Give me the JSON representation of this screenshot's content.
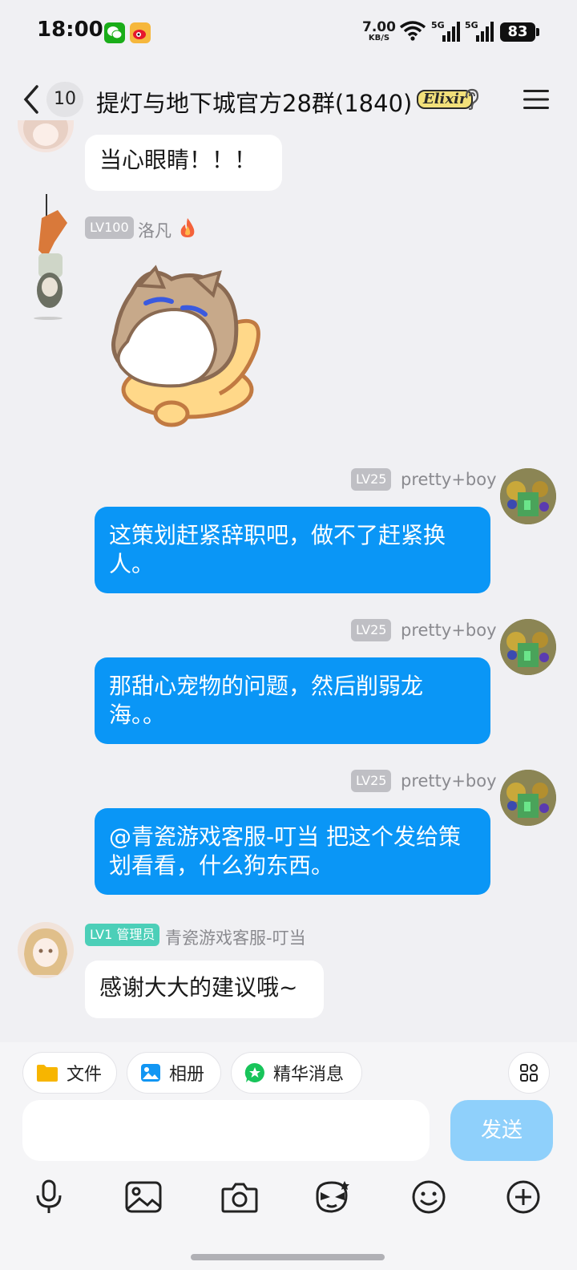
{
  "status_bar": {
    "time": "18:00",
    "net_speed_value": "7.00",
    "net_speed_unit": "KB/S",
    "signal_1": "5G",
    "signal_2": "5G",
    "battery": "83",
    "apps": [
      "wechat-icon",
      "weibo-icon"
    ]
  },
  "header": {
    "unread_count": "10",
    "title": "提灯与地下城官方28群(1840)",
    "badge": "Elixir"
  },
  "messages": [
    {
      "type": "text",
      "side": "in",
      "text": "当心眼睛！！！"
    },
    {
      "type": "sticker",
      "side": "in",
      "level": "LV100",
      "sender": "洛凡",
      "sender_icon": "fire-icon",
      "sticker": "cat-sticker"
    },
    {
      "type": "text",
      "side": "out",
      "level": "LV25",
      "sender": "pretty+boy",
      "text": "这策划赶紧辞职吧，做不了赶紧换人。"
    },
    {
      "type": "text",
      "side": "out",
      "level": "LV25",
      "sender": "pretty+boy",
      "text": "那甜心宠物的问题，然后削弱龙海。。"
    },
    {
      "type": "text",
      "side": "out",
      "level": "LV25",
      "sender": "pretty+boy",
      "text": "@青瓷游戏客服-叮当 把这个发给策划看看，什么狗东西。"
    },
    {
      "type": "text",
      "side": "in",
      "level": "LV1 管理员",
      "sender": "青瓷游戏客服-叮当",
      "text": "感谢大大的建议哦~"
    }
  ],
  "quick_actions": [
    {
      "label": "文件",
      "icon": "folder-icon"
    },
    {
      "label": "相册",
      "icon": "photo-icon"
    },
    {
      "label": "精华消息",
      "icon": "star-icon"
    }
  ],
  "composer": {
    "placeholder": "",
    "send_label": "发送"
  },
  "toolbar": [
    "microphone-icon",
    "image-icon",
    "camera-icon",
    "hongbao-face-icon",
    "emoji-icon",
    "plus-icon"
  ],
  "colors": {
    "accent": "#0a96f6",
    "send_disabled": "#8fd0fb",
    "background": "#f0f0f3",
    "admin_badge": "#4ccfb8"
  }
}
